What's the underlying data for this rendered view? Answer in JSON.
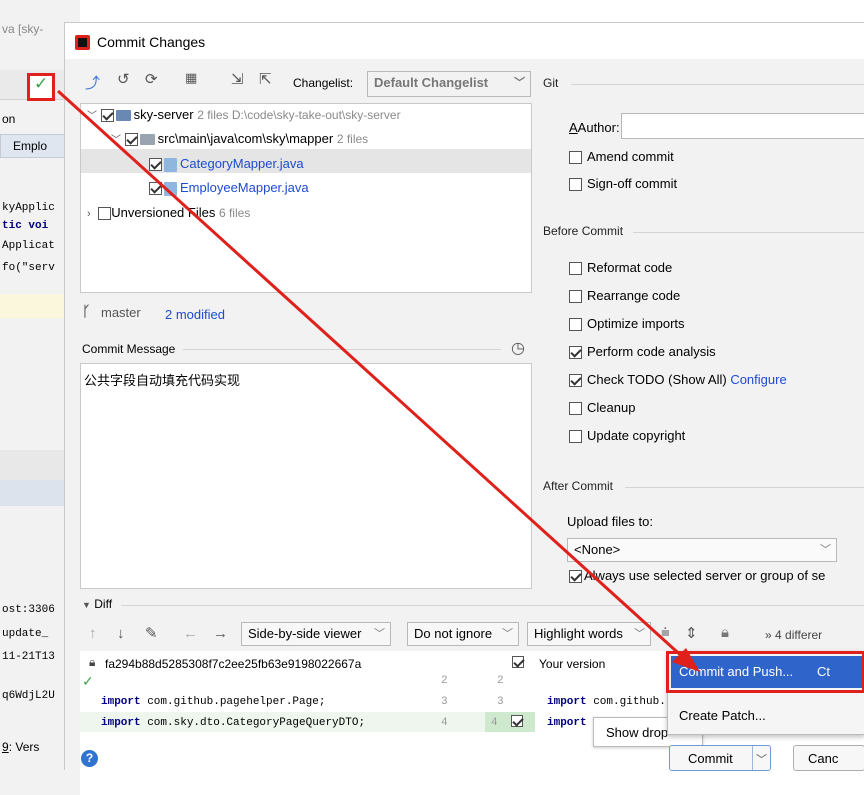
{
  "background": {
    "title_fragment": "va [sky-",
    "tab_fragment": "on",
    "tab_item": "Emplo",
    "code_lines": [
      "kyApplic",
      "tic voi",
      "Applicat",
      "fo(\"serv"
    ],
    "console_lines": [
      "ost:3306",
      "update_",
      "11-21T13",
      "q6WdjL2U"
    ],
    "bottom_tab_num": "9",
    "bottom_tab_label": ": Vers"
  },
  "dialog": {
    "title": "Commit Changes",
    "toolbar": {
      "changelist_label": "Changelist:",
      "changelist_value": "Default Changelist"
    },
    "tree": [
      {
        "label": "sky-server",
        "meta": "2 files  D:\\code\\sky-take-out\\sky-server"
      },
      {
        "label": "src\\main\\java\\com\\sky\\mapper",
        "meta": "2 files"
      },
      {
        "label": "CategoryMapper.java",
        "meta": ""
      },
      {
        "label": "EmployeeMapper.java",
        "meta": ""
      },
      {
        "label": "Unversioned Files",
        "meta": "6 files"
      }
    ],
    "branch": "master",
    "modified": "2 modified",
    "commit_message_label": "Commit Message",
    "commit_message": "公共字段自动填充代码实现",
    "git": {
      "section": "Git",
      "author_label": "Author:",
      "author_value": "",
      "amend": "Amend commit",
      "signoff": "Sign-off commit"
    },
    "before_commit": {
      "section": "Before Commit",
      "options": [
        {
          "label": "Reformat code",
          "checked": false
        },
        {
          "label": "Rearrange code",
          "checked": false
        },
        {
          "label": "Optimize imports",
          "checked": false
        },
        {
          "label": "Perform code analysis",
          "checked": true
        },
        {
          "label": "Check TODO (Show All)",
          "checked": true,
          "link": "Configure"
        },
        {
          "label": "Cleanup",
          "checked": false
        },
        {
          "label": "Update copyright",
          "checked": false
        }
      ]
    },
    "after_commit": {
      "section": "After Commit",
      "upload_label": "Upload files to:",
      "upload_value": "<None>",
      "always_use": "Always use selected server or group of se"
    },
    "diff": {
      "section": "Diff",
      "viewer": "Side-by-side viewer",
      "ignore": "Do not ignore",
      "highlight": "Highlight words",
      "differences": "4 differer",
      "left_title": "fa294b88d5285308f7c2ee25fb63e9198022667a",
      "right_title": "Your version",
      "left_lines": [
        {
          "kw": "import",
          "text": " com.github.pagehelper.Page;",
          "ln_left": "3",
          "ln_right": "3"
        },
        {
          "kw": "import",
          "text": " com.sky.dto.CategoryPageQueryDTO;",
          "ln_left": "4",
          "ln_right": "4"
        }
      ],
      "right_lines": [
        {
          "kw": "import",
          "text": " com.github."
        },
        {
          "kw": "import",
          "text": ""
        }
      ],
      "gutter_top": [
        "2",
        "2"
      ]
    },
    "popup": {
      "commit_and_push": "Commit and Push...",
      "shortcut": "Ct",
      "create_patch": "Create Patch...",
      "show_drop": "Show drop"
    },
    "buttons": {
      "commit": "Commit",
      "cancel": "Canc",
      "help": "?"
    }
  },
  "colors": {
    "highlight_red": "#e0201b",
    "popup_blue": "#2f65ca",
    "link_blue": "#1e4bd2"
  }
}
